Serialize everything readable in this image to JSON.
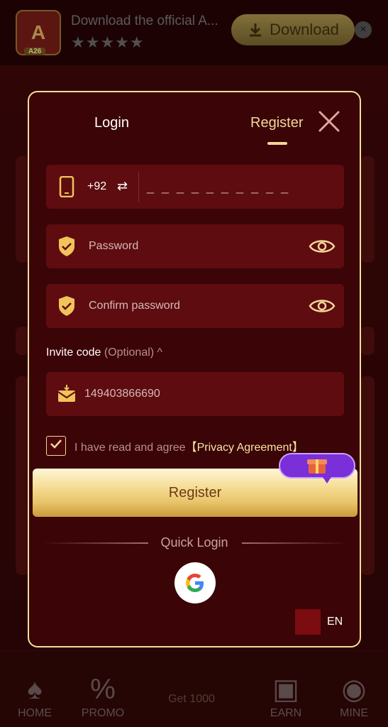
{
  "banner": {
    "app_tag": "A26",
    "title": "Download the official A...",
    "stars": "★★★★★",
    "download_label": "Download",
    "close_label": "×"
  },
  "tabbar": {
    "home": "HOME",
    "promo": "PROMO",
    "center": "Get 1000",
    "earn": "EARN",
    "mine": "MINE"
  },
  "modal": {
    "tab_login": "Login",
    "tab_register": "Register",
    "phone": {
      "country_code": "+92",
      "placeholder": "_ _ _ _ _ _ _ _ _ _"
    },
    "password_placeholder": "Password",
    "confirm_placeholder": "Confirm password",
    "invite": {
      "title": "Invite code",
      "optional": "(Optional)",
      "chevron": "^",
      "value": "149403866690"
    },
    "agree_text": "I have read and agree",
    "agree_link": "【Privacy Agreement】",
    "register_button": "Register",
    "quick_login": "Quick Login",
    "language": "EN"
  },
  "colors": {
    "modal_bg": "#3b0406",
    "field_bg": "#5e0c0f",
    "accent": "#f3d69a",
    "border": "#f3df9c"
  },
  "icons": [
    "phone-icon",
    "swap-icon",
    "shield-icon",
    "eye-icon",
    "envelope-icon",
    "check-icon",
    "gift-icon",
    "google-icon",
    "close-icon"
  ]
}
